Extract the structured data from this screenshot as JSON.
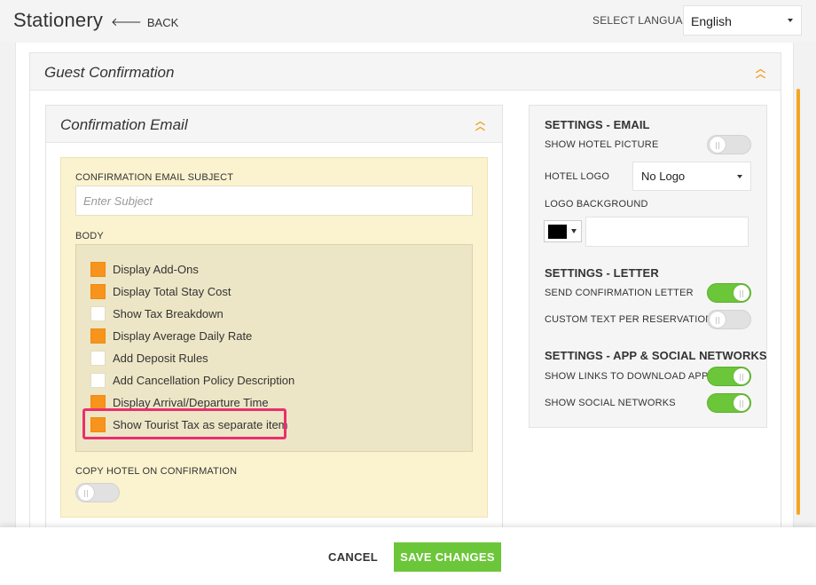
{
  "header": {
    "title": "Stationery",
    "back_label": "BACK",
    "language_label": "SELECT LANGUAGE",
    "language_value": "English"
  },
  "guest_confirmation": {
    "title": "Guest Confirmation"
  },
  "confirmation_email": {
    "title": "Confirmation Email",
    "subject_label": "CONFIRMATION EMAIL SUBJECT",
    "subject_placeholder": "Enter Subject",
    "body_label": "BODY",
    "options": [
      {
        "label": "Display Add-Ons",
        "checked": true
      },
      {
        "label": "Display Total Stay Cost",
        "checked": true
      },
      {
        "label": "Show Tax Breakdown",
        "checked": false
      },
      {
        "label": "Display Average Daily Rate",
        "checked": true
      },
      {
        "label": "Add Deposit Rules",
        "checked": false
      },
      {
        "label": "Add Cancellation Policy Description",
        "checked": false
      },
      {
        "label": "Display Arrival/Departure Time",
        "checked": true
      },
      {
        "label": "Show Tourist Tax as separate item",
        "checked": true
      }
    ],
    "copy_hotel_label": "COPY HOTEL ON CONFIRMATION",
    "copy_hotel_on": false
  },
  "settings": {
    "email_heading": "SETTINGS - EMAIL",
    "show_hotel_picture": {
      "label": "SHOW HOTEL PICTURE",
      "on": false
    },
    "hotel_logo": {
      "label": "HOTEL LOGO",
      "value": "No Logo"
    },
    "logo_background": {
      "label": "LOGO BACKGROUND",
      "color": "#000000"
    },
    "letter_heading": "SETTINGS - LETTER",
    "send_confirmation_letter": {
      "label": "SEND CONFIRMATION LETTER",
      "on": true
    },
    "custom_text": {
      "label": "CUSTOM TEXT PER RESERVATION",
      "on": false
    },
    "app_heading": "SETTINGS - APP & SOCIAL NETWORKS",
    "show_links_app": {
      "label": "SHOW LINKS TO DOWNLOAD APP",
      "on": true
    },
    "show_social": {
      "label": "SHOW SOCIAL NETWORKS",
      "on": true
    }
  },
  "footer": {
    "cancel_label": "CANCEL",
    "save_label": "SAVE CHANGES"
  },
  "colors": {
    "accent_orange": "#f7941d",
    "toggle_green": "#6cc63a",
    "highlight_pink": "#ec2e6e"
  }
}
